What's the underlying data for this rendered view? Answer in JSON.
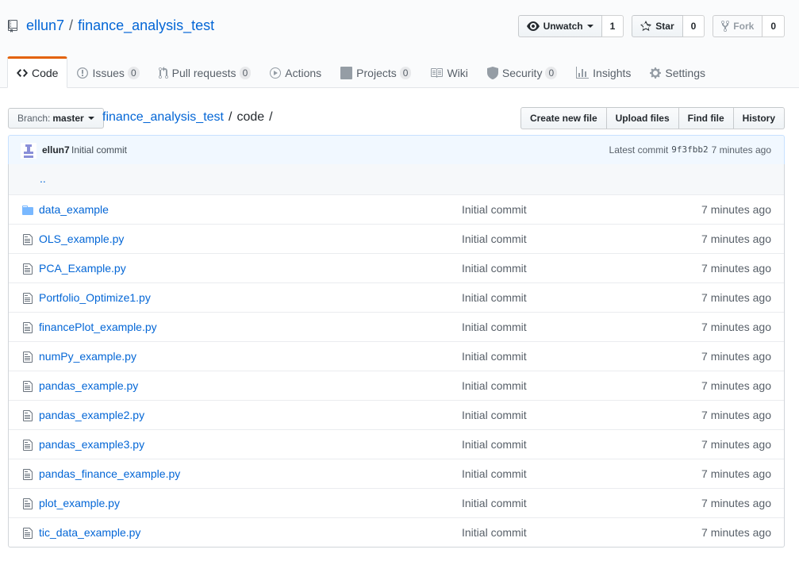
{
  "repo": {
    "owner": "ellun7",
    "separator": "/",
    "name": "finance_analysis_test",
    "actions": {
      "watch_label": "Unwatch",
      "watch_count": "1",
      "star_label": "Star",
      "star_count": "0",
      "fork_label": "Fork",
      "fork_count": "0"
    }
  },
  "nav": {
    "tabs": [
      {
        "label": "Code",
        "icon": "code-icon"
      },
      {
        "label": "Issues",
        "counter": "0",
        "icon": "issue-icon"
      },
      {
        "label": "Pull requests",
        "counter": "0",
        "icon": "pull-request-icon"
      },
      {
        "label": "Actions",
        "icon": "play-icon"
      },
      {
        "label": "Projects",
        "counter": "0",
        "icon": "project-icon"
      },
      {
        "label": "Wiki",
        "icon": "book-icon"
      },
      {
        "label": "Security",
        "counter": "0",
        "icon": "shield-icon"
      },
      {
        "label": "Insights",
        "icon": "graph-icon"
      },
      {
        "label": "Settings",
        "icon": "gear-icon"
      }
    ]
  },
  "file_nav": {
    "branch_label": "Branch:",
    "branch_value": "master",
    "breadcrumb_repo": "finance_analysis_test",
    "breadcrumb_sep": "/",
    "breadcrumb_dir": "code",
    "buttons": [
      "Create new file",
      "Upload files",
      "Find file",
      "History"
    ]
  },
  "commit": {
    "author": "ellun7",
    "message": "Initial commit",
    "latest_label": "Latest commit",
    "sha": "9f3fbb2",
    "age": "7 minutes ago"
  },
  "files": {
    "up_label": "..",
    "rows": [
      {
        "name": "data_example",
        "type": "dir",
        "message": "Initial commit",
        "age": "7 minutes ago"
      },
      {
        "name": "OLS_example.py",
        "type": "file",
        "message": "Initial commit",
        "age": "7 minutes ago"
      },
      {
        "name": "PCA_Example.py",
        "type": "file",
        "message": "Initial commit",
        "age": "7 minutes ago"
      },
      {
        "name": "Portfolio_Optimize1.py",
        "type": "file",
        "message": "Initial commit",
        "age": "7 minutes ago"
      },
      {
        "name": "financePlot_example.py",
        "type": "file",
        "message": "Initial commit",
        "age": "7 minutes ago"
      },
      {
        "name": "numPy_example.py",
        "type": "file",
        "message": "Initial commit",
        "age": "7 minutes ago"
      },
      {
        "name": "pandas_example.py",
        "type": "file",
        "message": "Initial commit",
        "age": "7 minutes ago"
      },
      {
        "name": "pandas_example2.py",
        "type": "file",
        "message": "Initial commit",
        "age": "7 minutes ago"
      },
      {
        "name": "pandas_example3.py",
        "type": "file",
        "message": "Initial commit",
        "age": "7 minutes ago"
      },
      {
        "name": "pandas_finance_example.py",
        "type": "file",
        "message": "Initial commit",
        "age": "7 minutes ago"
      },
      {
        "name": "plot_example.py",
        "type": "file",
        "message": "Initial commit",
        "age": "7 minutes ago"
      },
      {
        "name": "tic_data_example.py",
        "type": "file",
        "message": "Initial commit",
        "age": "7 minutes ago"
      }
    ]
  },
  "colors": {
    "link": "#0366d6",
    "selected_tab_accent": "#e36209",
    "commit_bg": "#f1f8ff",
    "folder_icon": "#79b8ff"
  }
}
